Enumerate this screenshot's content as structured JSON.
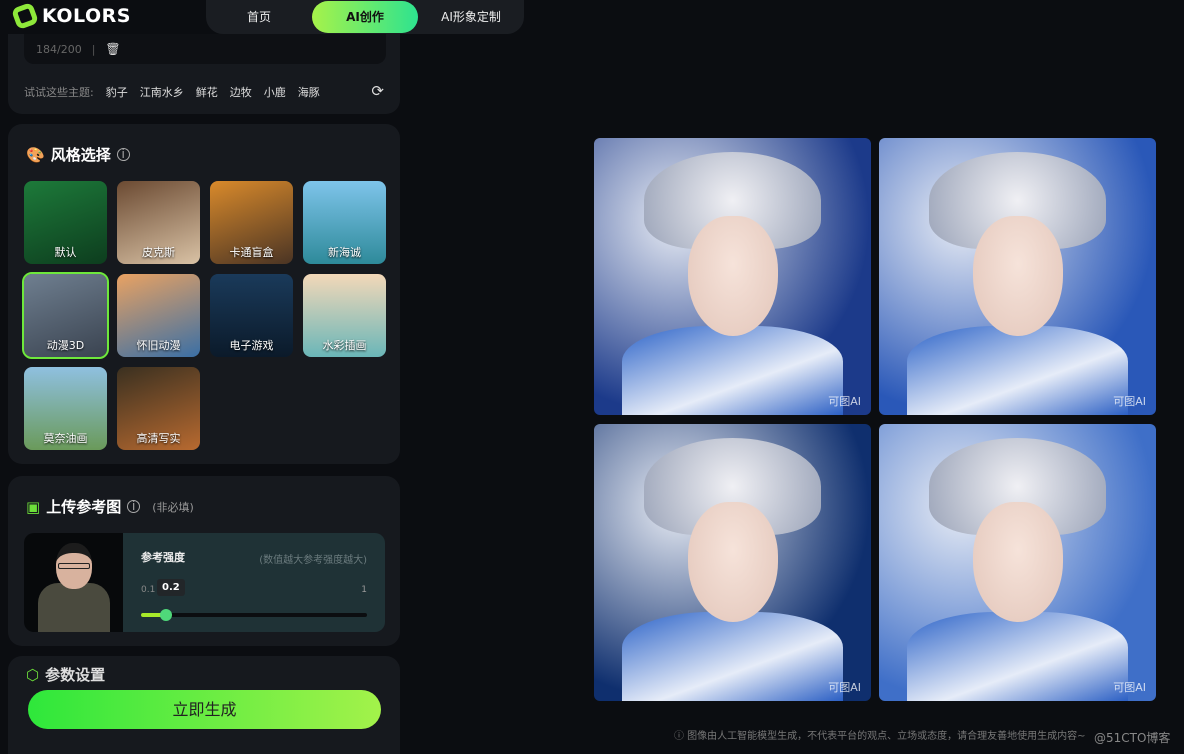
{
  "app": {
    "logo": "KOLORS"
  },
  "nav": {
    "items": [
      {
        "label": "首页"
      },
      {
        "label": "AI创作",
        "active": true
      },
      {
        "label": "AI形象定制"
      }
    ]
  },
  "prompt": {
    "counter": "184/200",
    "topics_label": "试试这些主题:",
    "topics": [
      "豹子",
      "江南水乡",
      "鲜花",
      "边牧",
      "小鹿",
      "海豚"
    ]
  },
  "style": {
    "title": "风格选择",
    "items": [
      {
        "label": "默认",
        "bg": "linear-gradient(160deg,#1d7a3a,#0d3d1e)"
      },
      {
        "label": "皮克斯",
        "bg": "linear-gradient(160deg,#6b4a32,#d9c2a5)"
      },
      {
        "label": "卡通盲盒",
        "bg": "linear-gradient(160deg,#d98a2b,#4a3424)"
      },
      {
        "label": "新海诚",
        "bg": "linear-gradient(180deg,#7ec4ea,#2e8a9a)"
      },
      {
        "label": "动漫3D",
        "bg": "linear-gradient(160deg,#6f7f90,#3a4350)",
        "selected": true
      },
      {
        "label": "怀旧动漫",
        "bg": "linear-gradient(160deg,#e9a262,#3a6fa5)"
      },
      {
        "label": "电子游戏",
        "bg": "linear-gradient(180deg,#1a3a5a,#0b1a2a)"
      },
      {
        "label": "水彩插画",
        "bg": "linear-gradient(180deg,#f3d8b8,#6ab6b8)"
      },
      {
        "label": "莫奈油画",
        "bg": "linear-gradient(180deg,#8fc0e0,#6a9a5a)"
      },
      {
        "label": "高清写实",
        "bg": "linear-gradient(160deg,#3a3020,#b86a30)"
      }
    ]
  },
  "reference": {
    "title": "上传参考图",
    "optional": "(非必填)",
    "strength_label": "参考强度",
    "strength_hint": "(数值越大参考强度越大)",
    "min": "0.1",
    "max": "1",
    "value": "0.2",
    "value_num": 0.2
  },
  "params": {
    "title": "参数设置"
  },
  "generate_label": "立即生成",
  "results": {
    "watermark": "可图AI",
    "count": 4
  },
  "disclaimer": "ⓘ 图像由人工智能模型生成，不代表平台的观点、立场或态度，请合理友善地使用生成内容~",
  "credit": "@51CTO博客",
  "colors": {
    "accent": "#8ee83a",
    "background": "#0b0d11"
  }
}
